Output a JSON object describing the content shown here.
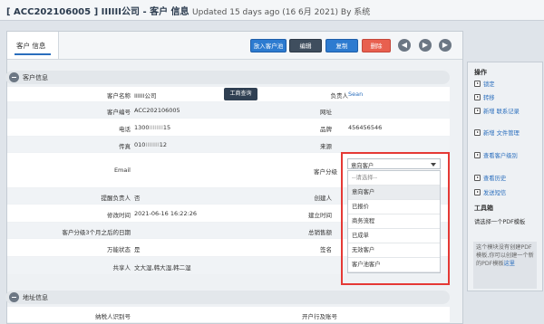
{
  "header": {
    "record_id": "[ ACC202106005 ]",
    "company": "IIIIII公司 - 客户 信息",
    "updated": "Updated 15 days ago (16 6月 2021) By 系统"
  },
  "tab": {
    "label": "客户 信息"
  },
  "toolbar": {
    "add_pool": "放入客户池",
    "edit": "编辑",
    "copy": "复制",
    "delete": "删除",
    "prev": "◀",
    "next": "▶"
  },
  "sections": {
    "customer_info": "客户信息",
    "address_info": "地址信息"
  },
  "fields": {
    "name_label": "客户名称",
    "name_value": "IIIIII公司",
    "owner_label": "负责人",
    "owner_value": "Sean",
    "code_label": "客户编号",
    "code_value": "ACC202106005",
    "website_label": "网址",
    "phone_label": "电话",
    "phone_prefix": "1300",
    "phone_mask": "IIIIIIII",
    "phone_suffix": "15",
    "brand_label": "品牌",
    "brand_value": "456456546",
    "fax_label": "传真",
    "fax_prefix": "010",
    "fax_mask": "IIIIIIII",
    "fax_suffix": "12",
    "source_label": "来源",
    "email_label": "Email",
    "category_label": "客户分级",
    "reminder_label": "提醒负责人",
    "reminder_value": "否",
    "creator_label": "创建人",
    "modify_label": "修改时间",
    "modify_value": "2021-06-16 16:22:26",
    "created_label": "建立时间",
    "date3m_label": "客户分级3个月之后的日期",
    "total_label": "总销售额",
    "status_label": "万能状态",
    "status_value": "是",
    "sign_label": "签名",
    "sharer_label": "共享人",
    "sharer_value": "文大湿,韩大湿,韩二湿",
    "taxid_label": "纳税人识别号",
    "bank_label": "开户行及账号"
  },
  "tooltip": "工商查询",
  "category_select": {
    "selected": "意向客户",
    "options": [
      "--请选择--",
      "意向客户",
      "已报价",
      "商务流程",
      "已成单",
      "无效客户",
      "客户池客户"
    ],
    "highlighted_index": 1
  },
  "sidebar": {
    "ops_title": "操作",
    "items": [
      "锁定",
      "转移",
      "新增 联系记录",
      "新增 文件管理",
      "查看客户级别",
      "查看历史",
      "发送短信"
    ],
    "toolbox_title": "工具箱",
    "pdf_text": "请选择一个PDF模板",
    "info_text": "这个模块没有创建PDF模板,你可以创建一个新的PDF模板",
    "info_link": "这里"
  }
}
